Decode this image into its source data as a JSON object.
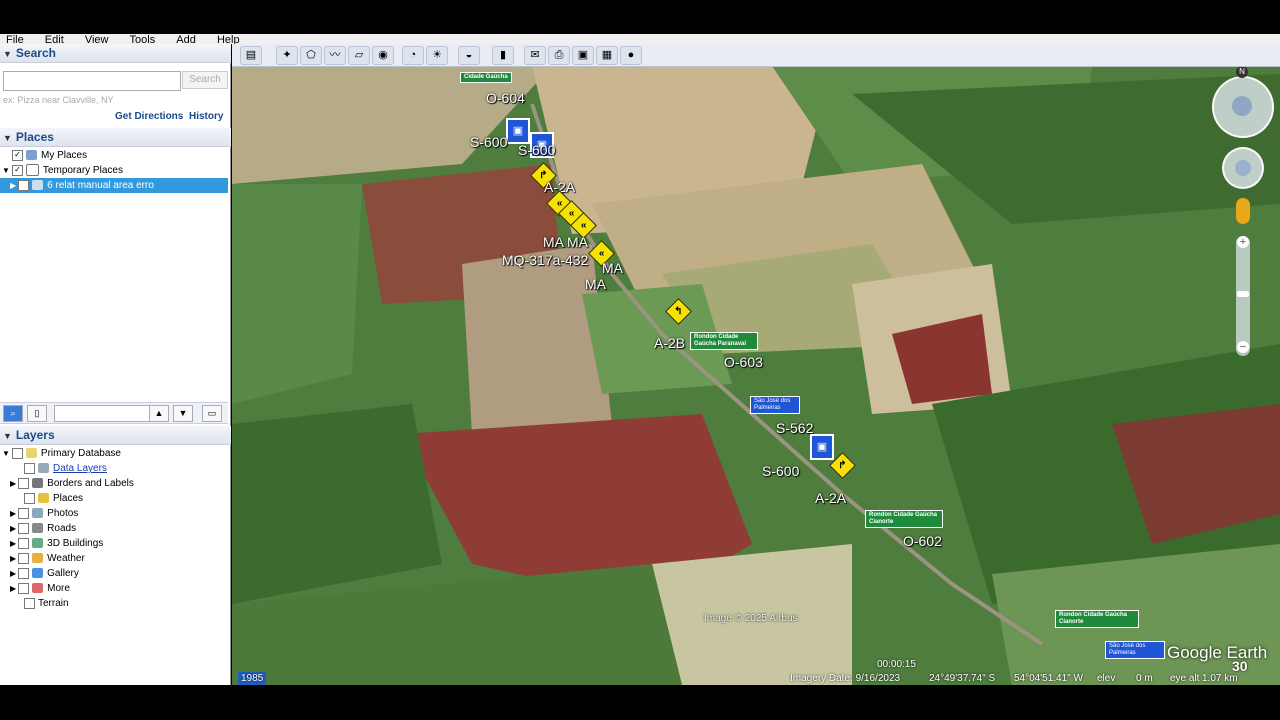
{
  "menu": [
    "File",
    "Edit",
    "View",
    "Tools",
    "Add",
    "Help"
  ],
  "search": {
    "title": "Search",
    "placeholder": "",
    "button": "Search",
    "hint": "ex: Pizza near Clavville, NY",
    "get_directions": "Get Directions",
    "history": "History"
  },
  "places": {
    "title": "Places",
    "items": [
      {
        "label": "My Places",
        "checked": true
      },
      {
        "label": "Temporary Places",
        "checked": true
      },
      {
        "label": "6 relat manual area erro",
        "checked": true,
        "selected": true
      }
    ]
  },
  "layers": {
    "title": "Layers",
    "items": [
      {
        "label": "Primary Database"
      },
      {
        "label": "Data Layers"
      },
      {
        "label": "Borders and Labels"
      },
      {
        "label": "Places"
      },
      {
        "label": "Photos"
      },
      {
        "label": "Roads"
      },
      {
        "label": "3D Buildings"
      },
      {
        "label": "Weather"
      },
      {
        "label": "Gallery"
      },
      {
        "label": "More"
      },
      {
        "label": "Terrain"
      }
    ]
  },
  "map_labels": {
    "o604": "O-604",
    "s600a": "S-600",
    "s600b": "S-600",
    "a2a_top": "A-2A",
    "ma1": "MA",
    "ma2": "MA",
    "mq": "MQ-317a-432",
    "ma3": "MA",
    "ma4": "MA",
    "a2b": "A-2B",
    "o603": "O-603",
    "s562": "S-562",
    "s600c": "S-600",
    "a2a_bot": "A-2A",
    "o602": "O-602"
  },
  "signs": {
    "g1": "Cidade Gaúcha",
    "g2": "Rondon Cidade Gaúcha Paranavaí",
    "g3": "Rondon Cidade Gaúcha Cianorte",
    "g4": "Rondon Cidade Gaúcha Cianorte",
    "b1": "São José dos Palmeiras",
    "b2": "São José dos Palmeiras"
  },
  "status": {
    "year": "1985",
    "imagery_date": "Imagery Date: 9/16/2023",
    "lat": "24°49'37.74\" S",
    "lon": "54°04'51.41\" W",
    "elev": "elev",
    "elev_val": "0 m",
    "eye": "eye alt",
    "eye_val": "1.07 km",
    "time": "00:00:15",
    "speed": "30"
  },
  "credit": "Image © 2025 Airbus",
  "logo": "Google Earth"
}
